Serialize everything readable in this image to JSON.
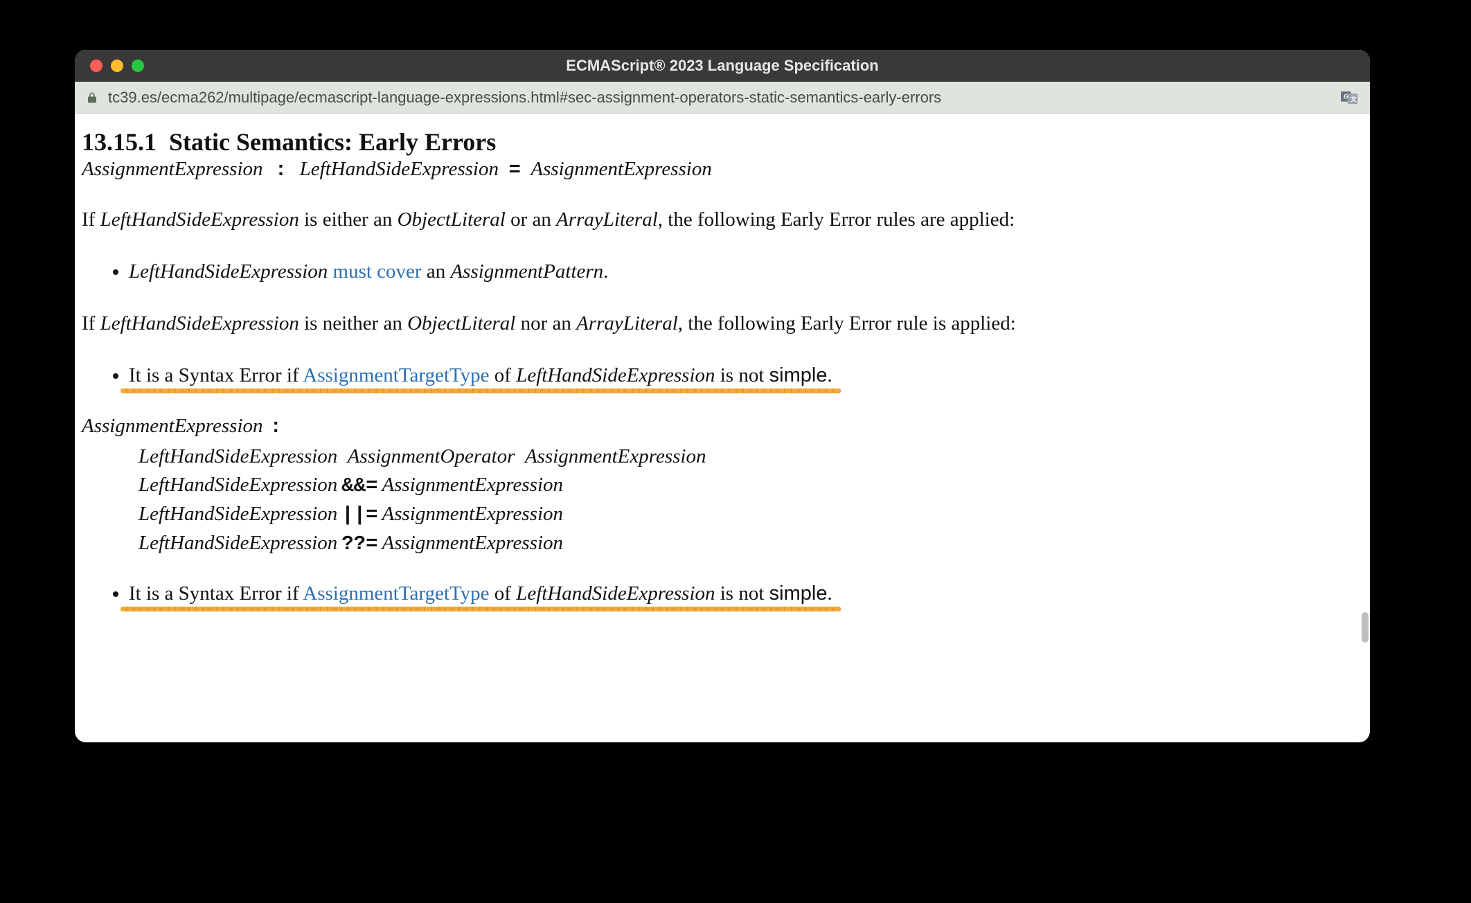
{
  "window": {
    "title": "ECMAScript® 2023 Language Specification",
    "url": "tc39.es/ecma262/multipage/ecmascript-language-expressions.html#sec-assignment-operators-static-semantics-early-errors"
  },
  "section": {
    "number": "13.15.1",
    "title": "Static Semantics: Early Errors"
  },
  "grammar_top": {
    "lhs": "AssignmentExpression",
    "colon": ":",
    "rhs_a": "LeftHandSideExpression",
    "eq": "=",
    "rhs_b": "AssignmentExpression"
  },
  "para1": {
    "pre": "If ",
    "nt1": "LeftHandSideExpression",
    "mid1": " is either an ",
    "nt2": "ObjectLiteral",
    "mid2": " or an ",
    "nt3": "ArrayLiteral",
    "post": ", the following Early Error rules are applied:"
  },
  "rule1": {
    "nt": "LeftHandSideExpression",
    "link": "must cover",
    "mid": " an ",
    "nt2": "AssignmentPattern",
    "end": "."
  },
  "para2": {
    "pre": "If ",
    "nt1": "LeftHandSideExpression",
    "mid1": " is neither an ",
    "nt2": "ObjectLiteral",
    "mid2": " nor an ",
    "nt3": "ArrayLiteral",
    "post": ", the following Early Error rule is applied:"
  },
  "rule2": {
    "pre": "It is a Syntax Error if ",
    "link": "AssignmentTargetType",
    "mid": " of ",
    "nt": "LeftHandSideExpression",
    "post1": " is not ",
    "simple": "simple",
    "end": "."
  },
  "grammar_block": {
    "head": "AssignmentExpression",
    "colon": ":",
    "prods": [
      {
        "a": "LeftHandSideExpression",
        "op": "",
        "b": "AssignmentOperator",
        "c": "AssignmentExpression"
      },
      {
        "a": "LeftHandSideExpression",
        "op": "&&=",
        "b": "AssignmentExpression",
        "c": ""
      },
      {
        "a": "LeftHandSideExpression",
        "op": "||=",
        "b": "AssignmentExpression",
        "c": ""
      },
      {
        "a": "LeftHandSideExpression",
        "op": "??=",
        "b": "AssignmentExpression",
        "c": ""
      }
    ]
  },
  "rule3": {
    "pre": "It is a Syntax Error if ",
    "link": "AssignmentTargetType",
    "mid": " of ",
    "nt": "LeftHandSideExpression",
    "post1": " is not ",
    "simple": "simple",
    "end": "."
  }
}
